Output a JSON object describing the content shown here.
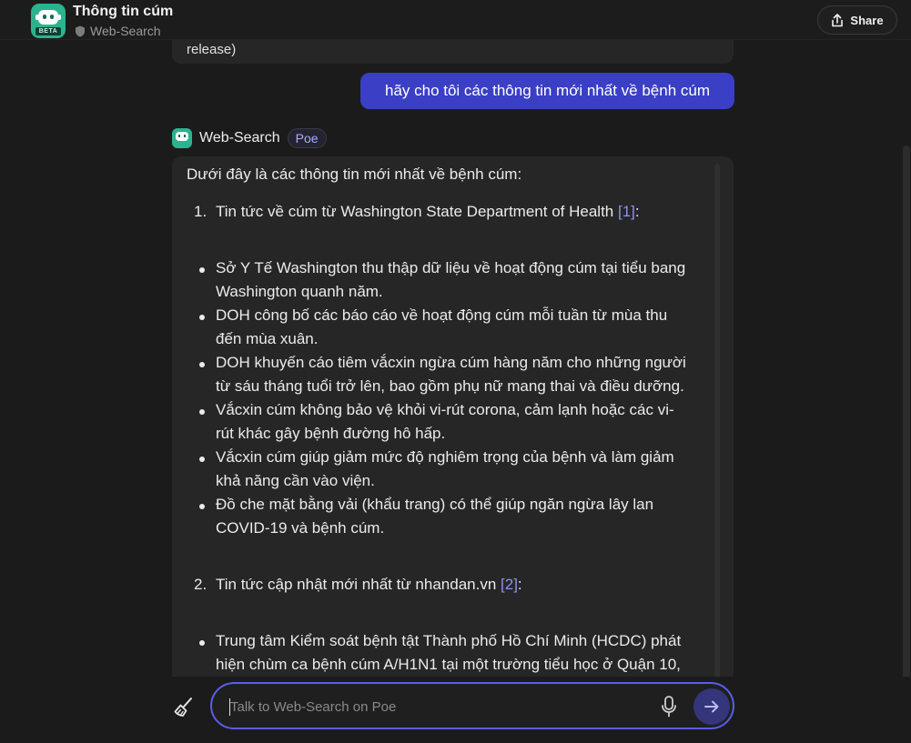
{
  "header": {
    "title": "Thông tin cúm",
    "bot_badge": "BETA",
    "subtitle": "Web-Search",
    "share_label": "Share"
  },
  "conversation": {
    "previous_message_tail": "release)",
    "user_message": "hãy cho tôi các thông tin mới nhất về bệnh cúm",
    "bot_name": "Web-Search",
    "bot_tag": "Poe",
    "reply": {
      "intro": "Dưới đây là các thông tin mới nhất về bệnh cúm:",
      "sections": [
        {
          "number": "1.",
          "title": "Tin tức về cúm từ Washington State Department of Health ",
          "citation": "[1]",
          "suffix": ":",
          "bullets": [
            [
              "Sở Y Tế Washington thu thập dữ liệu về hoạt động cúm tại tiểu bang",
              "Washington quanh năm."
            ],
            [
              "DOH công bố các báo cáo về hoạt động cúm mỗi tuần từ mùa thu",
              "đến mùa xuân."
            ],
            [
              "DOH khuyến cáo tiêm vắcxin ngừa cúm hàng năm cho những người",
              "từ sáu tháng tuổi trở lên, bao gồm phụ nữ mang thai và điều dưỡng."
            ],
            [
              "Vắcxin cúm không bảo vệ khỏi vi-rút corona, cảm lạnh hoặc các vi-",
              "rút khác gây bệnh đường hô hấp."
            ],
            [
              "Vắcxin cúm giúp giảm mức độ nghiêm trọng của bệnh và làm giảm",
              "khả năng cần vào viện."
            ],
            [
              "Đồ che mặt bằng vải (khẩu trang) có thể giúp ngăn ngừa lây lan",
              "COVID-19 và bệnh cúm."
            ]
          ]
        },
        {
          "number": "2.",
          "title": "Tin tức cập nhật mới nhất từ nhandan.vn ",
          "citation": "[2]",
          "suffix": ":",
          "bullets": [
            [
              "Trung tâm Kiểm soát bệnh tật Thành phố Hồ Chí Minh (HCDC) phát",
              "hiện chùm ca bệnh cúm A/H1N1 tại một trường tiểu học ở Quận 10,"
            ]
          ]
        }
      ]
    }
  },
  "composer": {
    "placeholder": "Talk to Web-Search on Poe",
    "value": ""
  },
  "colors": {
    "accent": "#3b3fc5",
    "bot_brand": "#2bb38f",
    "citation": "#8d8ff2",
    "input_border": "#5a5df0"
  }
}
